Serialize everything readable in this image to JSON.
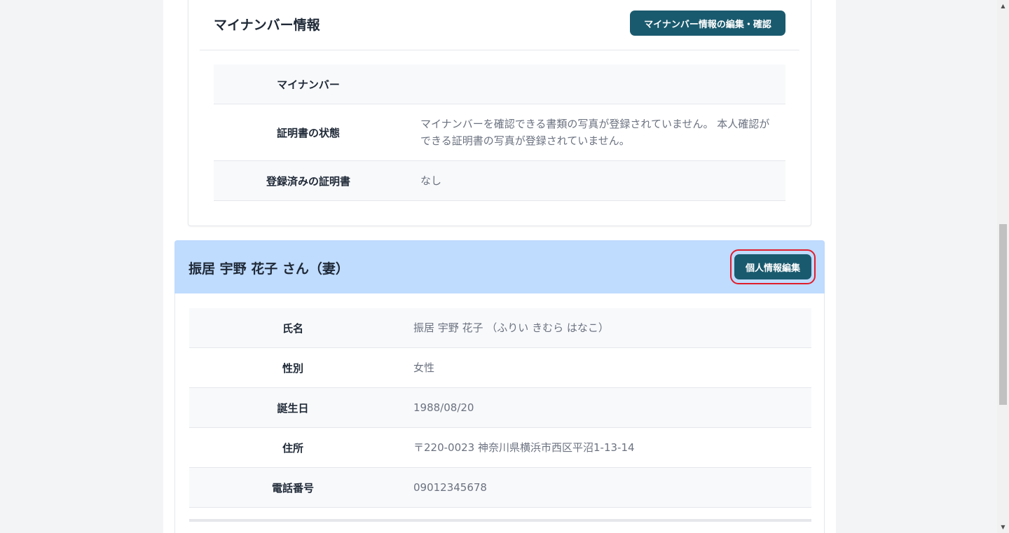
{
  "mynumber_section": {
    "title": "マイナンバー情報",
    "edit_button": "マイナンバー情報の編集・確認",
    "rows": [
      {
        "label": "マイナンバー",
        "value": ""
      },
      {
        "label": "証明書の状態",
        "value": "マイナンバーを確認できる書類の写真が登録されていません。 本人確認ができる証明書の写真が登録されていません。"
      },
      {
        "label": "登録済みの証明書",
        "value": "なし"
      }
    ]
  },
  "spouse_section": {
    "title": "振居 宇野 花子 さん（妻）",
    "edit_button": "個人情報編集",
    "rows": [
      {
        "label": "氏名",
        "value": "振居 宇野 花子 （ふりい きむら はなこ）"
      },
      {
        "label": "性別",
        "value": "女性"
      },
      {
        "label": "誕生日",
        "value": "1988/08/20"
      },
      {
        "label": "住所",
        "value": "〒220-0023 神奈川県横浜市西区平沼1-13-14"
      },
      {
        "label": "電話番号",
        "value": "09012345678"
      }
    ]
  },
  "colors": {
    "primary_button": "#1a5a6e",
    "spouse_header_bg": "#bfdbfe",
    "highlight_ring": "#e11d2a"
  },
  "scrollbar": {
    "up_icon": "triangle-up-icon",
    "down_icon": "triangle-down-icon"
  }
}
